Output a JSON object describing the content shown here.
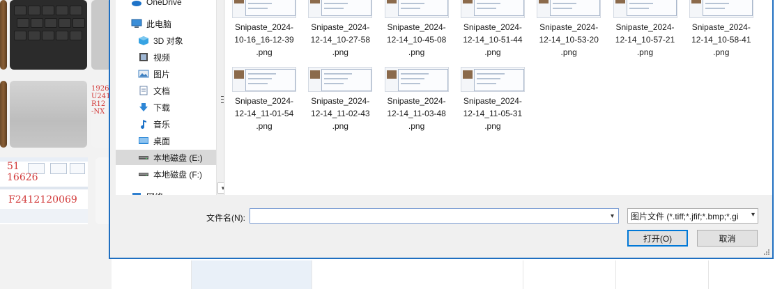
{
  "nav": {
    "items": [
      {
        "label": "OneDrive",
        "icon": "onedrive-cloud-icon",
        "color": "#1e73c8"
      },
      {
        "label": "此电脑",
        "icon": "this-pc-icon",
        "color": "#3a8ed8"
      },
      {
        "label": "3D 对象",
        "icon": "3d-objects-icon",
        "color": "#37a3e3"
      },
      {
        "label": "视频",
        "icon": "video-icon",
        "color": "#4a4a4a"
      },
      {
        "label": "图片",
        "icon": "pictures-icon",
        "color": "#3c7fc1"
      },
      {
        "label": "文档",
        "icon": "documents-icon",
        "color": "#6b86a8"
      },
      {
        "label": "下载",
        "icon": "downloads-icon",
        "color": "#2d86d6"
      },
      {
        "label": "音乐",
        "icon": "music-icon",
        "color": "#1e73c8"
      },
      {
        "label": "桌面",
        "icon": "desktop-icon",
        "color": "#2f8ad8"
      },
      {
        "label": "本地磁盘 (E:)",
        "icon": "drive-icon",
        "color": "#555555"
      },
      {
        "label": "本地磁盘 (F:)",
        "icon": "drive-icon",
        "color": "#555555"
      },
      {
        "label": "网络",
        "icon": "network-icon",
        "color": "#2f7fcf"
      }
    ],
    "selected": "本地磁盘 (E:)"
  },
  "files": [
    {
      "name": "Snipaste_2024-10-16_16-12-39.png"
    },
    {
      "name": "Snipaste_2024-12-14_10-27-58.png"
    },
    {
      "name": "Snipaste_2024-12-14_10-45-08.png"
    },
    {
      "name": "Snipaste_2024-12-14_10-51-44.png"
    },
    {
      "name": "Snipaste_2024-12-14_10-53-20.png"
    },
    {
      "name": "Snipaste_2024-12-14_10-57-21.png"
    },
    {
      "name": "Snipaste_2024-12-14_10-58-41.png"
    },
    {
      "name": "Snipaste_2024-12-14_11-01-54.png"
    },
    {
      "name": "Snipaste_2024-12-14_11-02-43.png"
    },
    {
      "name": "Snipaste_2024-12-14_11-03-48.png"
    },
    {
      "name": "Snipaste_2024-12-14_11-05-31.png"
    }
  ],
  "bottom": {
    "filename_label": "文件名(N):",
    "filename_value": "",
    "filter_value": "图片文件 (*.tiff;*.jfif;*.bmp;*.gi",
    "open_label": "打开(O)",
    "cancel_label": "取消"
  },
  "background": {
    "red_text_1": [
      "1926",
      "U241",
      "R12",
      "-NX"
    ],
    "red_text_2": [
      "51",
      "16626"
    ],
    "red_text_3": "F2412120069"
  },
  "colors": {
    "dialog_border": "#1f6fc1",
    "selection": "#d9d9d9",
    "accent": "#0078d7"
  }
}
